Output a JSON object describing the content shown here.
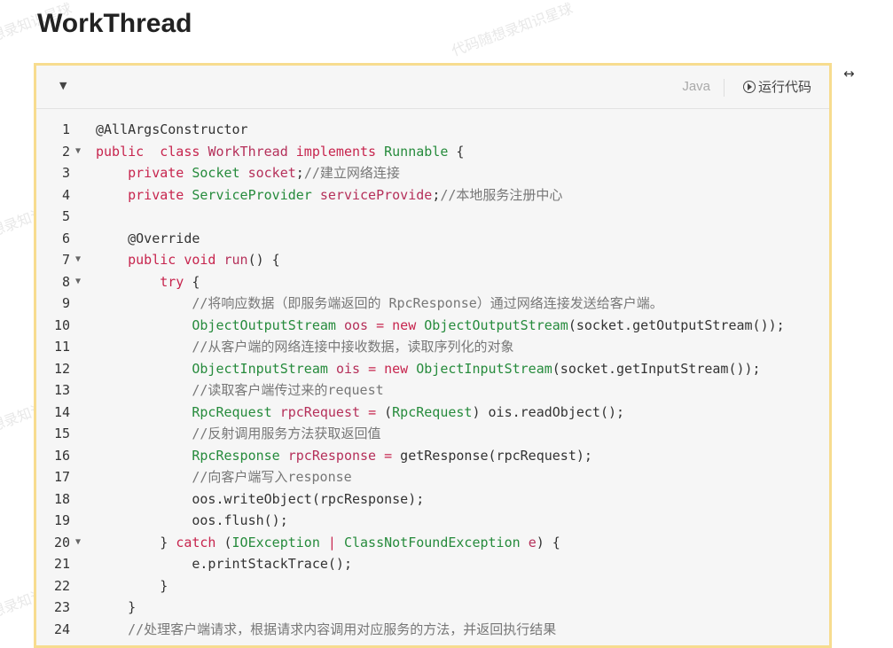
{
  "title": "WorkThread",
  "watermark": "代码随想录知识星球",
  "toolbar": {
    "collapse_icon": "caret-down-icon",
    "language": "Java",
    "run_label": "运行代码"
  },
  "expand_icon": "↔",
  "code": [
    {
      "n": "1",
      "fold": false,
      "tokens": [
        [
          "an",
          "@AllArgsConstructor"
        ]
      ]
    },
    {
      "n": "2",
      "fold": true,
      "tokens": [
        [
          "kw",
          "public"
        ],
        [
          "",
          "  "
        ],
        [
          "kw",
          "class"
        ],
        [
          "",
          " "
        ],
        [
          "vr",
          "WorkThread"
        ],
        [
          "",
          " "
        ],
        [
          "kw",
          "implements"
        ],
        [
          "",
          " "
        ],
        [
          "ty",
          "Runnable"
        ],
        [
          "",
          " {"
        ]
      ]
    },
    {
      "n": "3",
      "fold": false,
      "tokens": [
        [
          "",
          "    "
        ],
        [
          "kw",
          "private"
        ],
        [
          "",
          " "
        ],
        [
          "ty",
          "Socket"
        ],
        [
          "",
          " "
        ],
        [
          "vr",
          "socket"
        ],
        [
          "",
          ";"
        ],
        [
          "cm",
          "//建立网络连接"
        ]
      ]
    },
    {
      "n": "4",
      "fold": false,
      "tokens": [
        [
          "",
          "    "
        ],
        [
          "kw",
          "private"
        ],
        [
          "",
          " "
        ],
        [
          "ty",
          "ServiceProvider"
        ],
        [
          "",
          " "
        ],
        [
          "vr",
          "serviceProvide"
        ],
        [
          "",
          ";"
        ],
        [
          "cm",
          "//本地服务注册中心"
        ]
      ]
    },
    {
      "n": "5",
      "fold": false,
      "tokens": [
        [
          "",
          ""
        ]
      ]
    },
    {
      "n": "6",
      "fold": false,
      "tokens": [
        [
          "",
          "    "
        ],
        [
          "an",
          "@Override"
        ]
      ]
    },
    {
      "n": "7",
      "fold": true,
      "tokens": [
        [
          "",
          "    "
        ],
        [
          "kw",
          "public"
        ],
        [
          "",
          " "
        ],
        [
          "kw",
          "void"
        ],
        [
          "",
          " "
        ],
        [
          "vr",
          "run"
        ],
        [
          "",
          "() {"
        ]
      ]
    },
    {
      "n": "8",
      "fold": true,
      "tokens": [
        [
          "",
          "        "
        ],
        [
          "kw",
          "try"
        ],
        [
          "",
          " {"
        ]
      ]
    },
    {
      "n": "9",
      "fold": false,
      "tokens": [
        [
          "",
          "            "
        ],
        [
          "cm",
          "//将响应数据（即服务端返回的 RpcResponse）通过网络连接发送给客户端。"
        ]
      ]
    },
    {
      "n": "10",
      "fold": false,
      "tokens": [
        [
          "",
          "            "
        ],
        [
          "ty",
          "ObjectOutputStream"
        ],
        [
          "",
          " "
        ],
        [
          "vr",
          "oos"
        ],
        [
          "",
          " "
        ],
        [
          "kw",
          "="
        ],
        [
          "",
          " "
        ],
        [
          "kw",
          "new"
        ],
        [
          "",
          " "
        ],
        [
          "ty",
          "ObjectOutputStream"
        ],
        [
          "",
          "(socket."
        ],
        [
          "",
          "getOutputStream());"
        ]
      ]
    },
    {
      "n": "11",
      "fold": false,
      "tokens": [
        [
          "",
          "            "
        ],
        [
          "cm",
          "//从客户端的网络连接中接收数据，读取序列化的对象"
        ]
      ]
    },
    {
      "n": "12",
      "fold": false,
      "tokens": [
        [
          "",
          "            "
        ],
        [
          "ty",
          "ObjectInputStream"
        ],
        [
          "",
          " "
        ],
        [
          "vr",
          "ois"
        ],
        [
          "",
          " "
        ],
        [
          "kw",
          "="
        ],
        [
          "",
          " "
        ],
        [
          "kw",
          "new"
        ],
        [
          "",
          " "
        ],
        [
          "ty",
          "ObjectInputStream"
        ],
        [
          "",
          "(socket.getInputStream());"
        ]
      ]
    },
    {
      "n": "13",
      "fold": false,
      "tokens": [
        [
          "",
          "            "
        ],
        [
          "cm",
          "//读取客户端传过来的request"
        ]
      ]
    },
    {
      "n": "14",
      "fold": false,
      "tokens": [
        [
          "",
          "            "
        ],
        [
          "ty",
          "RpcRequest"
        ],
        [
          "",
          " "
        ],
        [
          "vr",
          "rpcRequest"
        ],
        [
          "",
          " "
        ],
        [
          "kw",
          "="
        ],
        [
          "",
          " ("
        ],
        [
          "ty",
          "RpcRequest"
        ],
        [
          "",
          ") ois.readObject();"
        ]
      ]
    },
    {
      "n": "15",
      "fold": false,
      "tokens": [
        [
          "",
          "            "
        ],
        [
          "cm",
          "//反射调用服务方法获取返回值"
        ]
      ]
    },
    {
      "n": "16",
      "fold": false,
      "tokens": [
        [
          "",
          "            "
        ],
        [
          "ty",
          "RpcResponse"
        ],
        [
          "",
          " "
        ],
        [
          "vr",
          "rpcResponse"
        ],
        [
          "",
          " "
        ],
        [
          "kw",
          "="
        ],
        [
          "",
          " getResponse(rpcRequest);"
        ]
      ]
    },
    {
      "n": "17",
      "fold": false,
      "tokens": [
        [
          "",
          "            "
        ],
        [
          "cm",
          "//向客户端写入response"
        ]
      ]
    },
    {
      "n": "18",
      "fold": false,
      "tokens": [
        [
          "",
          "            oos.writeObject(rpcResponse);"
        ]
      ]
    },
    {
      "n": "19",
      "fold": false,
      "tokens": [
        [
          "",
          "            oos.flush();"
        ]
      ]
    },
    {
      "n": "20",
      "fold": true,
      "tokens": [
        [
          "",
          "        } "
        ],
        [
          "kw",
          "catch"
        ],
        [
          "",
          " ("
        ],
        [
          "ty",
          "IOException"
        ],
        [
          "",
          " "
        ],
        [
          "kw",
          "|"
        ],
        [
          "",
          " "
        ],
        [
          "ty",
          "ClassNotFoundException"
        ],
        [
          "",
          " "
        ],
        [
          "vr",
          "e"
        ],
        [
          "",
          ") {"
        ]
      ]
    },
    {
      "n": "21",
      "fold": false,
      "tokens": [
        [
          "",
          "            e.printStackTrace();"
        ]
      ]
    },
    {
      "n": "22",
      "fold": false,
      "tokens": [
        [
          "",
          "        }"
        ]
      ]
    },
    {
      "n": "23",
      "fold": false,
      "tokens": [
        [
          "",
          "    }"
        ]
      ]
    },
    {
      "n": "24",
      "fold": false,
      "tokens": [
        [
          "",
          "    "
        ],
        [
          "cm",
          "//处理客户端请求，根据请求内容调用对应服务的方法，并返回执行结果"
        ]
      ]
    }
  ]
}
